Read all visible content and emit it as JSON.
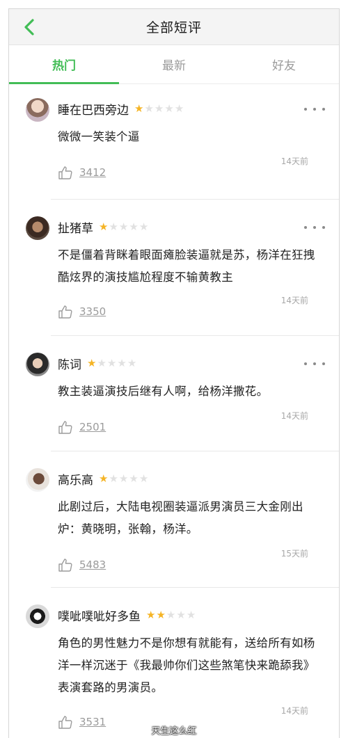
{
  "header": {
    "title": "全部短评"
  },
  "tabs": [
    {
      "label": "热门"
    },
    {
      "label": "最新"
    },
    {
      "label": "好友"
    }
  ],
  "colors": {
    "accent": "#42bd56",
    "star_on": "#f5b425",
    "star_off": "#e1e1e1"
  },
  "reviews": [
    {
      "user": "睡在巴西旁边",
      "rating": 1,
      "text": "微微一笑装个逼",
      "likes": "3412",
      "time": "14天前"
    },
    {
      "user": "扯猪草",
      "rating": 1,
      "text": "不是僵着背眯着眼面瘫脸装逼就是苏，杨洋在狂拽酷炫界的演技尴尬程度不输黄教主",
      "likes": "3350",
      "time": "14天前"
    },
    {
      "user": "陈词",
      "rating": 1,
      "text": "教主装逼演技后继有人啊，给杨洋撒花。",
      "likes": "2501",
      "time": "14天前"
    },
    {
      "user": "高乐高",
      "rating": 1,
      "text": "此剧过后，大陆电视圈装逼派男演员三大金刚出炉：黄晓明，张翰，杨洋。",
      "likes": "5483",
      "time": "15天前"
    },
    {
      "user": "噗呲噗呲好多鱼",
      "rating": 2,
      "text": "角色的男性魅力不是你想有就能有，送给所有如杨洋一样沉迷于《我最帅你们这些煞笔快来跪舔我》表演套路的男演员。",
      "likes": "3531",
      "time": "14天前"
    }
  ],
  "watermark": "天生这么红"
}
